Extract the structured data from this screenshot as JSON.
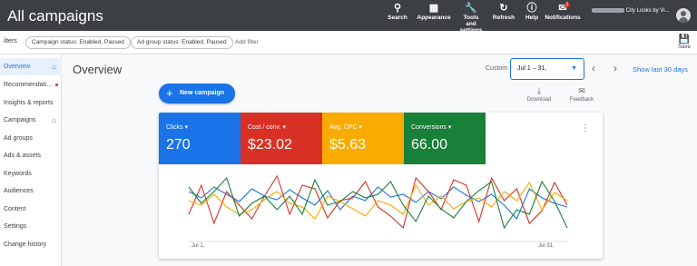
{
  "header": {
    "title": "All campaigns",
    "tools": [
      {
        "icon": "search-icon",
        "label": "Search"
      },
      {
        "icon": "appearance-icon",
        "label": "Appearance"
      },
      {
        "icon": "tools-icon",
        "label": "Tools and settings"
      },
      {
        "icon": "refresh-icon",
        "label": "Refresh"
      },
      {
        "icon": "help-icon",
        "label": "Help"
      },
      {
        "icon": "bell-icon",
        "label": "Notifications"
      }
    ],
    "notification_count": "1",
    "account_name": "City Looks by Vi..."
  },
  "filterbar": {
    "label": "ilters",
    "chips": [
      "Campaign status: Enabled, Paused",
      "Ad group status: Enabled, Paused"
    ],
    "add_filter": "Add filter",
    "save_label": "Save"
  },
  "sidebar": {
    "items": [
      {
        "label": "Overview",
        "active": true,
        "home": true
      },
      {
        "label": "Recommendations",
        "dot": true
      },
      {
        "label": "Insights & reports"
      },
      {
        "label": "Campaigns",
        "home": true
      },
      {
        "label": "Ad groups"
      },
      {
        "label": "Ads & assets"
      },
      {
        "label": "Keywords"
      },
      {
        "label": "Audiences"
      },
      {
        "label": "Content"
      },
      {
        "label": "Settings"
      },
      {
        "label": "Change history"
      }
    ]
  },
  "main": {
    "title": "Overview",
    "custom_label": "Custom",
    "date_range": "Jul 1 – 31,",
    "show_last": "Show last 30 days",
    "new_campaign": "New campaign",
    "download": "Download",
    "feedback": "Feedback"
  },
  "metrics": [
    {
      "label": "Clicks",
      "value": "270",
      "color": "#1a73e8"
    },
    {
      "label": "Cost / conv.",
      "value": "$23.02",
      "color": "#d93025"
    },
    {
      "label": "Avg. CPC",
      "value": "$5.63",
      "color": "#f9ab00"
    },
    {
      "label": "Conversions",
      "value": "66.00",
      "color": "#188038"
    }
  ],
  "chart_data": {
    "type": "line",
    "x_start_label": "Jul 1,",
    "x_end_label": "Jul 31,",
    "series": [
      {
        "color": "#1a73e8",
        "values": [
          55,
          48,
          60,
          52,
          44,
          58,
          50,
          46,
          57,
          48,
          40,
          56,
          35,
          50,
          45,
          60,
          49,
          52,
          43,
          55,
          47,
          60,
          51,
          44,
          52,
          40,
          25,
          58,
          48,
          42,
          38
        ]
      },
      {
        "color": "#d93025",
        "values": [
          30,
          62,
          20,
          55,
          40,
          25,
          50,
          72,
          30,
          62,
          58,
          26,
          45,
          48,
          66,
          38,
          28,
          15,
          70,
          55,
          35,
          68,
          62,
          22,
          70,
          45,
          58,
          20,
          34,
          65,
          40
        ]
      },
      {
        "color": "#f9ab00",
        "values": [
          45,
          40,
          52,
          38,
          30,
          35,
          46,
          55,
          42,
          38,
          25,
          50,
          44,
          36,
          28,
          45,
          40,
          30,
          62,
          40,
          50,
          36,
          44,
          48,
          38,
          55,
          45,
          65,
          35,
          54,
          45
        ]
      },
      {
        "color": "#188038",
        "values": [
          60,
          42,
          55,
          70,
          28,
          42,
          50,
          35,
          50,
          30,
          68,
          40,
          44,
          55,
          48,
          52,
          66,
          40,
          22,
          50,
          36,
          26,
          44,
          56,
          66,
          15,
          35,
          30,
          66,
          44,
          15
        ]
      }
    ]
  }
}
